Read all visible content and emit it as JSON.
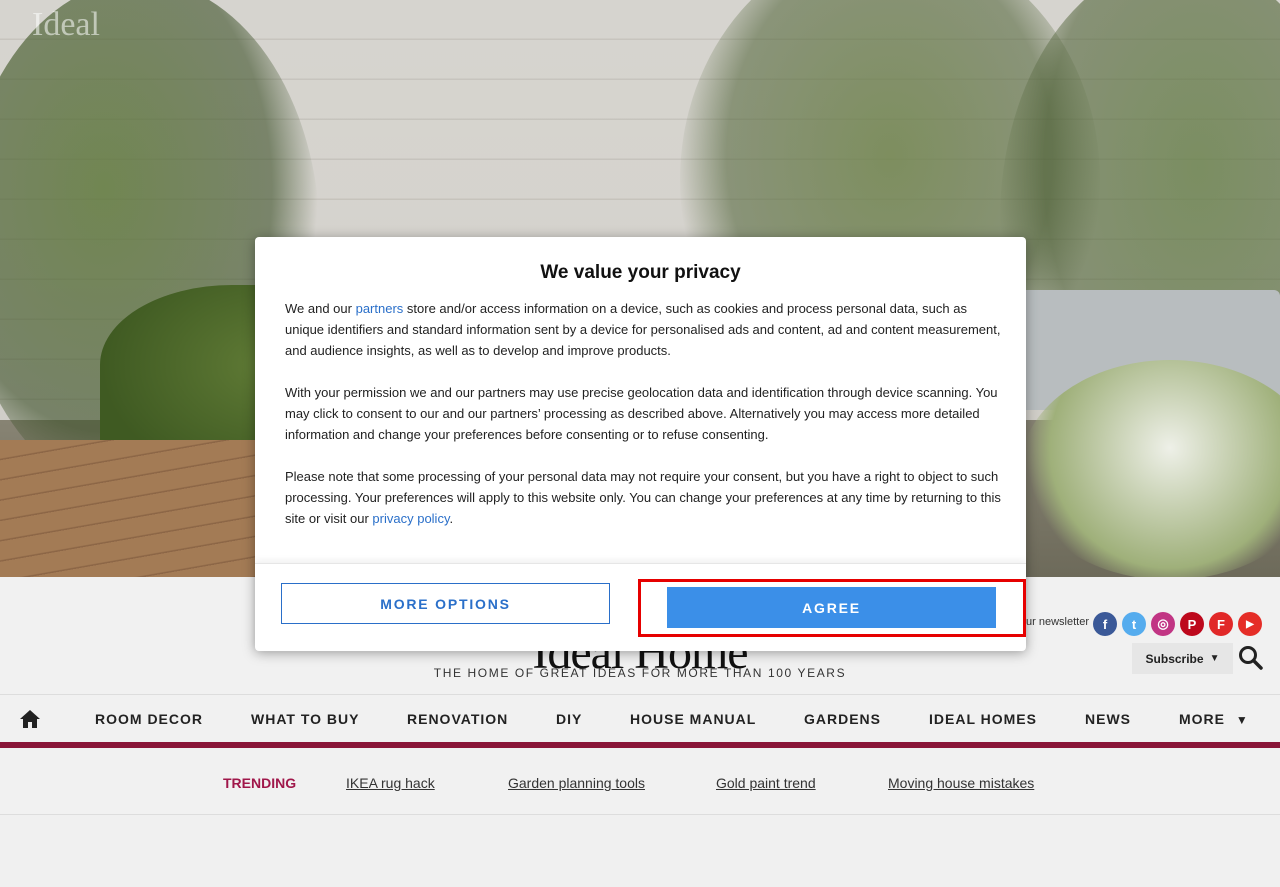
{
  "hero": {
    "logo_text": "Ideal"
  },
  "header": {
    "brand": "Ideal Home",
    "tagline": "THE HOME OF GREAT IDEAS FOR MORE THAN 100 YEARS",
    "newsletter_text": "ur newsletter",
    "subscribe_label": "Subscribe",
    "social": [
      {
        "name": "facebook",
        "glyph": "f",
        "color": "#3b5998"
      },
      {
        "name": "twitter",
        "glyph": "t",
        "color": "#55acee"
      },
      {
        "name": "instagram",
        "glyph": "◎",
        "color": "#c13584"
      },
      {
        "name": "pinterest",
        "glyph": "P",
        "color": "#bd081c"
      },
      {
        "name": "flipboard",
        "glyph": "F",
        "color": "#e12828"
      },
      {
        "name": "youtube",
        "glyph": "▶",
        "color": "#e52d27"
      }
    ]
  },
  "nav": {
    "items": [
      "ROOM DECOR",
      "WHAT TO BUY",
      "RENOVATION",
      "DIY",
      "HOUSE MANUAL",
      "GARDENS",
      "IDEAL HOMES",
      "NEWS"
    ],
    "more_label": "MORE",
    "accent_color": "#8a1538"
  },
  "trending": {
    "label": "TRENDING",
    "links": [
      "IKEA rug hack",
      "Garden planning tools",
      "Gold paint trend",
      "Moving house mistakes"
    ]
  },
  "consent": {
    "title": "We value your privacy",
    "p1_before": "We and our ",
    "p1_link": "partners",
    "p1_after": " store and/or access information on a device, such as cookies and process personal data, such as unique identifiers and standard information sent by a device for personalised ads and content, ad and content measurement, and audience insights, as well as to develop and improve products.",
    "p2": "With your permission we and our partners may use precise geolocation data and identification through device scanning. You may click to consent to our and our partners’ processing as described above. Alternatively you may access more detailed information and change your preferences before consenting or to refuse consenting.",
    "p3_before": "Please note that some processing of your personal data may not require your consent, but you have a right to object to such processing. Your preferences will apply to this website only. You can change your preferences at any time by returning to this site or visit our ",
    "p3_link": "privacy policy",
    "p3_after": ".",
    "more_options_label": "MORE OPTIONS",
    "agree_label": "AGREE"
  }
}
